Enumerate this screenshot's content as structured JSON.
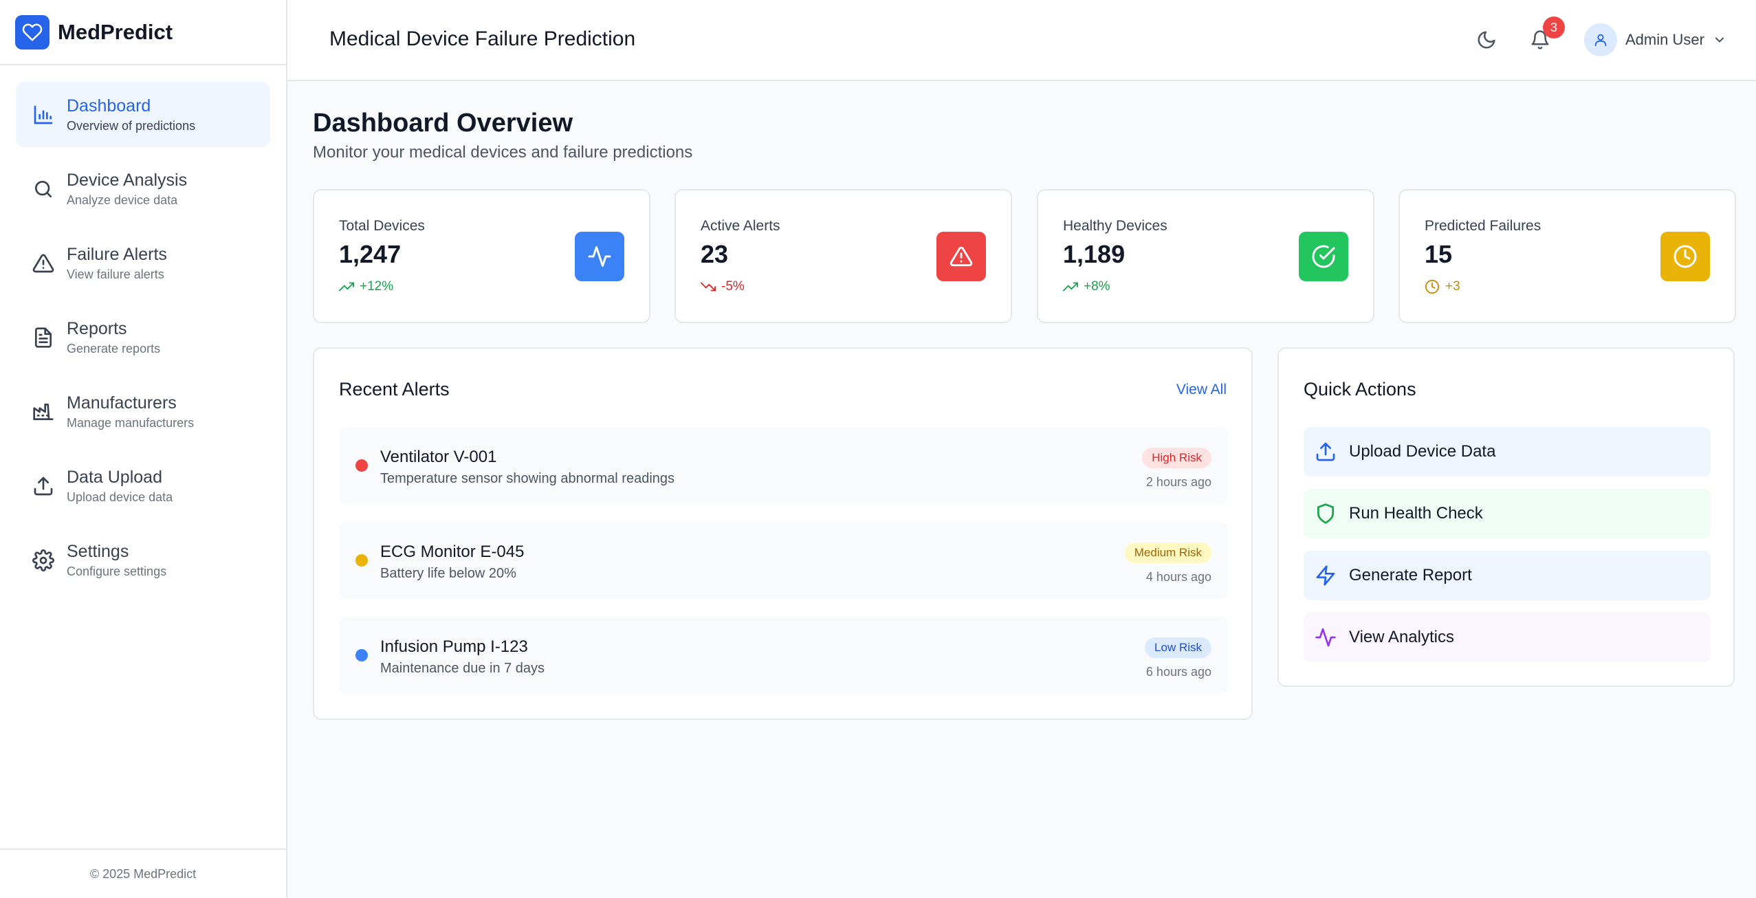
{
  "app": {
    "name": "MedPredict",
    "footer": "© 2025 MedPredict"
  },
  "sidebar": {
    "items": [
      {
        "label": "Dashboard",
        "sub": "Overview of predictions",
        "icon": "bar-chart-icon",
        "active": true
      },
      {
        "label": "Device Analysis",
        "sub": "Analyze device data",
        "icon": "search-icon"
      },
      {
        "label": "Failure Alerts",
        "sub": "View failure alerts",
        "icon": "warning-icon"
      },
      {
        "label": "Reports",
        "sub": "Generate reports",
        "icon": "document-icon"
      },
      {
        "label": "Manufacturers",
        "sub": "Manage manufacturers",
        "icon": "factory-icon"
      },
      {
        "label": "Data Upload",
        "sub": "Upload device data",
        "icon": "upload-icon"
      },
      {
        "label": "Settings",
        "sub": "Configure settings",
        "icon": "gear-icon"
      }
    ]
  },
  "header": {
    "title": "Medical Device Failure Prediction",
    "notification_count": "3",
    "user_name": "Admin User"
  },
  "page": {
    "title": "Dashboard Overview",
    "subtitle": "Monitor your medical devices and failure predictions"
  },
  "stats": [
    {
      "label": "Total Devices",
      "value": "1,247",
      "trend": "+12%",
      "trend_color": "#16a34a",
      "icon_bg": "#3b82f6",
      "icon": "activity-icon"
    },
    {
      "label": "Active Alerts",
      "value": "23",
      "trend": "-5%",
      "trend_color": "#dc2626",
      "icon_bg": "#ef4444",
      "icon": "warning-icon"
    },
    {
      "label": "Healthy Devices",
      "value": "1,189",
      "trend": "+8%",
      "trend_color": "#16a34a",
      "icon_bg": "#22c55e",
      "icon": "check-circle-icon"
    },
    {
      "label": "Predicted Failures",
      "value": "15",
      "trend": "+3",
      "trend_color": "#ca8a04",
      "icon_bg": "#eab308",
      "icon": "clock-icon"
    }
  ],
  "recent_alerts": {
    "title": "Recent Alerts",
    "view_all": "View All",
    "items": [
      {
        "name": "Ventilator V-001",
        "desc": "Temperature sensor showing abnormal readings",
        "risk": "High Risk",
        "time": "2 hours ago",
        "dot": "#ef4444",
        "badge_bg": "#fee2e2",
        "badge_fg": "#dc2626"
      },
      {
        "name": "ECG Monitor E-045",
        "desc": "Battery life below 20%",
        "risk": "Medium Risk",
        "time": "4 hours ago",
        "dot": "#eab308",
        "badge_bg": "#fef9c3",
        "badge_fg": "#a16207"
      },
      {
        "name": "Infusion Pump I-123",
        "desc": "Maintenance due in 7 days",
        "risk": "Low Risk",
        "time": "6 hours ago",
        "dot": "#3b82f6",
        "badge_bg": "#dbeafe",
        "badge_fg": "#1d4ed8"
      }
    ]
  },
  "quick_actions": {
    "title": "Quick Actions",
    "items": [
      {
        "label": "Upload Device Data",
        "icon": "upload-icon",
        "bg": "#eff6ff",
        "color": "#2563eb"
      },
      {
        "label": "Run Health Check",
        "icon": "shield-icon",
        "bg": "#f0fdf4",
        "color": "#16a34a"
      },
      {
        "label": "Generate Report",
        "icon": "lightning-icon",
        "bg": "#eff6ff",
        "color": "#2563eb"
      },
      {
        "label": "View Analytics",
        "icon": "activity-icon",
        "bg": "#faf5ff",
        "color": "#9333ea"
      }
    ]
  }
}
